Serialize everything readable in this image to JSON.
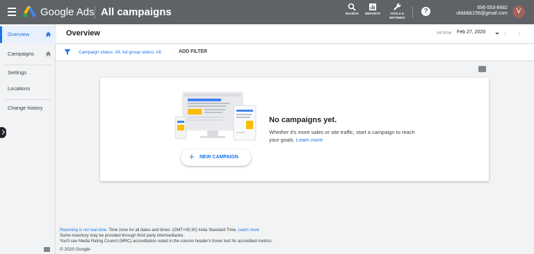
{
  "topbar": {
    "brand": "Google Ads",
    "page_title": "All campaigns",
    "tools": [
      {
        "label": "SEARCH",
        "icon": "search-icon"
      },
      {
        "label": "REPORTS",
        "icon": "reports-icon"
      },
      {
        "label_line1": "TOOLS &",
        "label_line2": "SETTINGS",
        "icon": "wrench-icon"
      }
    ],
    "help": "?",
    "account_phone": "696-553-8682",
    "account_email": "vbbbbb156@gmail.com",
    "avatar_letter": "V"
  },
  "sidebar": {
    "items": [
      {
        "label": "Overview",
        "active": true
      },
      {
        "label": "Campaigns",
        "active": false
      },
      {
        "label": "Settings",
        "active": false
      },
      {
        "label": "Locations",
        "active": false
      },
      {
        "label": "Change history",
        "active": false
      }
    ]
  },
  "overview": {
    "title": "Overview",
    "date_range_label": "All time",
    "date_value": "Feb 27, 2020",
    "prev": "‹",
    "next": "›"
  },
  "filter": {
    "text": "Campaign status: All; Ad group status: All",
    "add_filter": "ADD FILTER"
  },
  "empty_state": {
    "title": "No campaigns yet.",
    "description": "Whether it's more sales or site traffic, start a campaign to reach your goals.",
    "learn_more": "Learn more",
    "button_plus": "+",
    "button_label": "NEW CAMPAIGN"
  },
  "footer": {
    "reporting_link": "Reporting is not real-time.",
    "timezone_text": "Time zone for all dates and times: (GMT+05:30) India Standard Time.",
    "learn_more": "Learn more",
    "line2": "Some inventory may be provided through third party intermediaries.",
    "line3": "You'll see Media Rating Council (MRC) accreditation noted in the column header's hover text for accredited metrics.",
    "copyright": "© 2020 Google"
  },
  "colors": {
    "topbar": "#5f6368",
    "accent": "#1a73e8",
    "avatar": "#a1635a"
  }
}
